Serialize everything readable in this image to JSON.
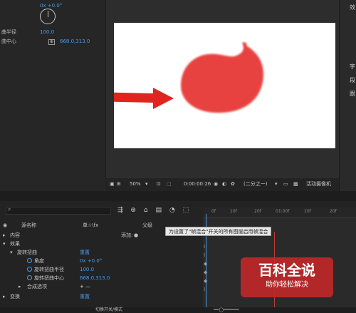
{
  "effect_panel": {
    "angle_value": "0x +0.0°",
    "twirl_radius_label": "曲半径",
    "twirl_radius_value": "100.0",
    "twirl_center_label": "曲中心",
    "twirl_center_value": "668.0,313.0"
  },
  "viewer": {
    "zoom": "50%",
    "timecode": "0:00:00:26",
    "resolution": "(二分之一)",
    "camera": "活动摄像机"
  },
  "right_panel": {
    "items": [
      "效",
      "字",
      "段",
      "跟"
    ]
  },
  "timeline": {
    "column_source": "源名称",
    "column_switches": "单☆\\fx",
    "column_parent": "父级",
    "tooltip": "为设置了\"帧混合\"开关的所有图层启用帧混合",
    "rows": [
      {
        "label": "内容",
        "extra": "添加:"
      },
      {
        "label": "效果"
      },
      {
        "label": "旋转扭曲",
        "value": "重置"
      },
      {
        "label": "角度",
        "value": "0x +0.0°"
      },
      {
        "label": "旋转扭曲半径",
        "value": "100.0"
      },
      {
        "label": "旋转扭曲中心",
        "value": "668.0,313.0"
      },
      {
        "label": "合成选项",
        "value": "+ —"
      },
      {
        "label": "变换",
        "value": "重置"
      }
    ],
    "ruler_labels": [
      "0f",
      "10f",
      "20f",
      "01:00f",
      "10f",
      "20f"
    ],
    "bottom_label": "切换开关/模式"
  },
  "watermark": {
    "title": "百科全说",
    "subtitle": "助你轻松解决"
  },
  "colors": {
    "accent_blue": "#4a9ae8",
    "shape_red": "#e8433f",
    "arrow_red": "#e0241f"
  }
}
